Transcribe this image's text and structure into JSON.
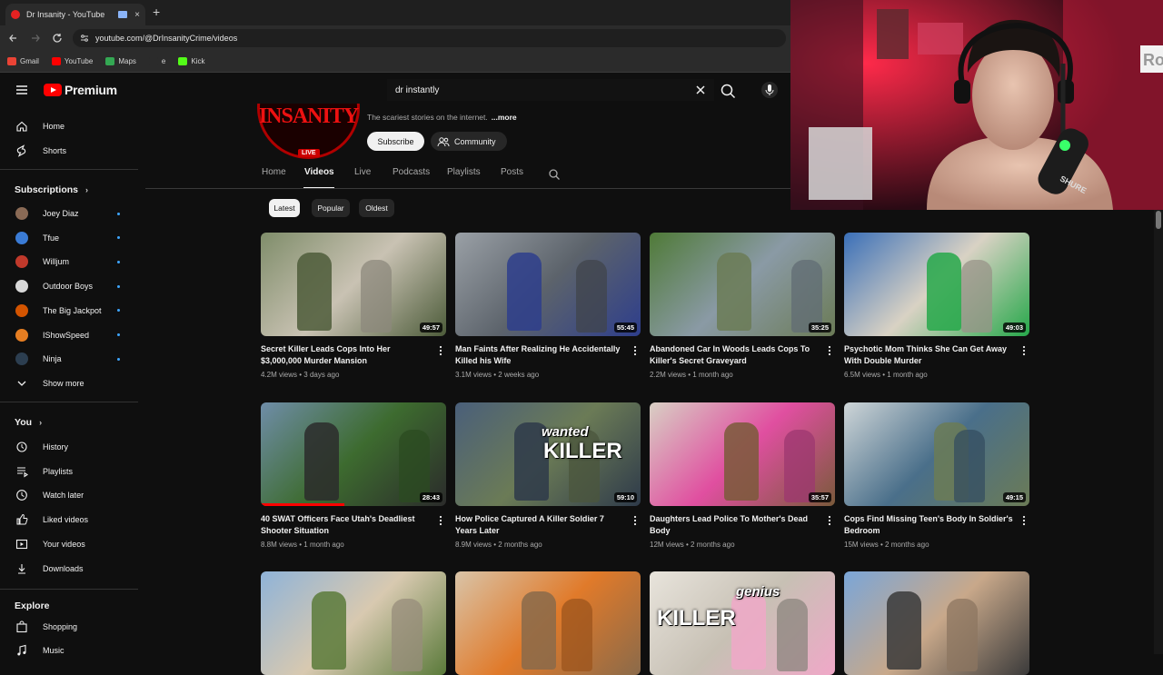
{
  "browser": {
    "tab_title": "Dr Insanity - YouTube",
    "new_tab_label": "+",
    "close_label": "×",
    "url": "youtube.com/@DrInsanityCrime/videos",
    "bookmarks": [
      {
        "label": "Gmail",
        "color": "#ea4335"
      },
      {
        "label": "YouTube",
        "color": "#ff0000"
      },
      {
        "label": "Maps",
        "color": "#34a853"
      },
      {
        "label": "e",
        "color": "#2b2b2b"
      },
      {
        "label": "Kick",
        "color": "#53fc18"
      }
    ]
  },
  "masthead": {
    "logo_text": "Premium",
    "search_value": "dr instantly",
    "accent": "#ff0000"
  },
  "sidebar": {
    "primary": [
      {
        "label": "Home",
        "icon": "home-icon"
      },
      {
        "label": "Shorts",
        "icon": "shorts-icon"
      }
    ],
    "subscriptions_heading": "Subscriptions",
    "subscriptions": [
      {
        "label": "Joey Diaz",
        "color": "#8a6a55"
      },
      {
        "label": "Tfue",
        "color": "#3a7bd5"
      },
      {
        "label": "Willjum",
        "color": "#c0392b"
      },
      {
        "label": "Outdoor Boys",
        "color": "#d8d8d8"
      },
      {
        "label": "The Big Jackpot",
        "color": "#d35400"
      },
      {
        "label": "IShowSpeed",
        "color": "#e67e22"
      },
      {
        "label": "Ninja",
        "color": "#2c3e50"
      }
    ],
    "show_more": "Show more",
    "you_heading": "You",
    "you_items": [
      {
        "label": "History",
        "icon": "history-icon"
      },
      {
        "label": "Playlists",
        "icon": "playlists-icon"
      },
      {
        "label": "Watch later",
        "icon": "watch-later-icon"
      },
      {
        "label": "Liked videos",
        "icon": "liked-icon"
      },
      {
        "label": "Your videos",
        "icon": "your-videos-icon"
      },
      {
        "label": "Downloads",
        "icon": "download-icon"
      }
    ],
    "explore_heading": "Explore",
    "explore_items": [
      {
        "label": "Shopping",
        "icon": "shopping-icon"
      },
      {
        "label": "Music",
        "icon": "music-icon"
      }
    ]
  },
  "channel": {
    "avatar_text": "INSANITY",
    "live_badge": "LIVE",
    "description": "The scariest stories on the internet.",
    "more_label": "...more",
    "subscribe_label": "Subscribe",
    "community_label": "Community",
    "tabs": [
      "Home",
      "Videos",
      "Live",
      "Podcasts",
      "Playlists",
      "Posts"
    ],
    "active_tab": "Videos",
    "chips": [
      "Latest",
      "Popular",
      "Oldest"
    ],
    "active_chip": "Latest"
  },
  "videos": [
    {
      "title": "Secret Killer Leads Cops Into Her $3,000,000 Murder Mansion",
      "views": "4.2M views",
      "age": "3 days ago",
      "duration": "49:57",
      "colors": [
        "#7f8d6a",
        "#c9c2b3",
        "#4d5c3a"
      ],
      "watched": 0
    },
    {
      "title": "Man Faints After Realizing He Accidentally Killed his Wife",
      "views": "3.1M views",
      "age": "2 weeks ago",
      "duration": "55:45",
      "colors": [
        "#9aa0a6",
        "#5c636b",
        "#2e3e8c"
      ],
      "watched": 0
    },
    {
      "title": "Abandoned Car In Woods Leads Cops To Killer's Secret Graveyard",
      "views": "2.2M views",
      "age": "1 month ago",
      "duration": "35:25",
      "colors": [
        "#4f7a37",
        "#8a9aa5",
        "#6b7b56"
      ],
      "watched": 0
    },
    {
      "title": "Psychotic Mom Thinks She Can Get Away With Double Murder",
      "views": "6.5M views",
      "age": "1 month ago",
      "duration": "49:03",
      "colors": [
        "#3a6fb8",
        "#d9d2c4",
        "#26a84a"
      ],
      "watched": 0
    },
    {
      "title": "40 SWAT Officers Face Utah's Deadliest Shooter Situation",
      "views": "8.8M views",
      "age": "1 month ago",
      "duration": "28:43",
      "colors": [
        "#6f8da8",
        "#3d6b2f",
        "#2b2b2b"
      ],
      "watched": 0.45
    },
    {
      "title": "How Police Captured A Killer Soldier 7 Years Later",
      "views": "8.9M views",
      "age": "2 months ago",
      "duration": "59:10",
      "colors": [
        "#4a5f7a",
        "#6b7b56",
        "#2e3a4a"
      ],
      "watched": 0,
      "overlay": "KILLER",
      "overlay2": "wanted"
    },
    {
      "title": "Daughters Lead Police To Mother's Dead Body",
      "views": "12M views",
      "age": "2 months ago",
      "duration": "35:57",
      "colors": [
        "#d8d0c4",
        "#e04fa0",
        "#7a5a3a"
      ],
      "watched": 0
    },
    {
      "title": "Cops Find Missing Teen's Body In Soldier's Bedroom",
      "views": "15M views",
      "age": "2 months ago",
      "duration": "49:15",
      "colors": [
        "#cfd6d8",
        "#4a6f8a",
        "#6b7b56"
      ],
      "watched": 0
    },
    {
      "title": "",
      "views": "",
      "age": "",
      "duration": "",
      "colors": [
        "#8fb3d8",
        "#d8c9b0",
        "#5a7a3a"
      ],
      "watched": 0
    },
    {
      "title": "",
      "views": "",
      "age": "",
      "duration": "",
      "colors": [
        "#d9c4a8",
        "#e07a2a",
        "#8a6a4a"
      ],
      "watched": 0
    },
    {
      "title": "",
      "views": "",
      "age": "",
      "duration": "",
      "colors": [
        "#e8e4dc",
        "#c7c0b4",
        "#f0a8c8"
      ],
      "watched": 0,
      "overlay": "KILLER",
      "overlay2": "genius"
    },
    {
      "title": "",
      "views": "",
      "age": "",
      "duration": "",
      "colors": [
        "#7aa6d8",
        "#c8a88a",
        "#3a3a3a"
      ],
      "watched": 0
    }
  ],
  "webcam": {
    "mic_brand": "SHURE",
    "corner_text": "Ro"
  }
}
